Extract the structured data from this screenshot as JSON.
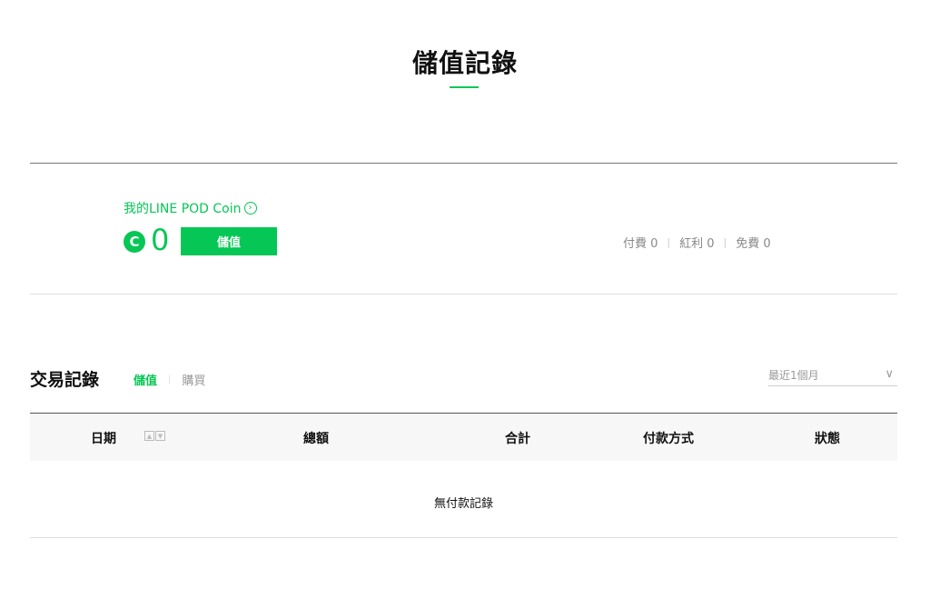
{
  "page": {
    "title": "儲值記錄"
  },
  "coin": {
    "label": "我的LINE POD Coin",
    "label_arrow": "›",
    "icon_letter": "C",
    "amount": "0",
    "topup_label": "儲值",
    "paid": "付費 0",
    "bonus": "紅利 0",
    "free": "免費 0",
    "separator": "|"
  },
  "transactions": {
    "title": "交易記錄",
    "tabs": [
      {
        "label": "儲值",
        "active": true
      },
      {
        "label": "購買",
        "active": false
      }
    ],
    "period": "最近1個月",
    "period_chevron": "∨",
    "columns": [
      "日期",
      "總額",
      "合計",
      "付款方式",
      "狀態"
    ],
    "sort_up": "▲",
    "sort_down": "▼",
    "empty_message": "無付款記錄"
  },
  "colors": {
    "accent": "#06c755",
    "muted": "#888888"
  }
}
